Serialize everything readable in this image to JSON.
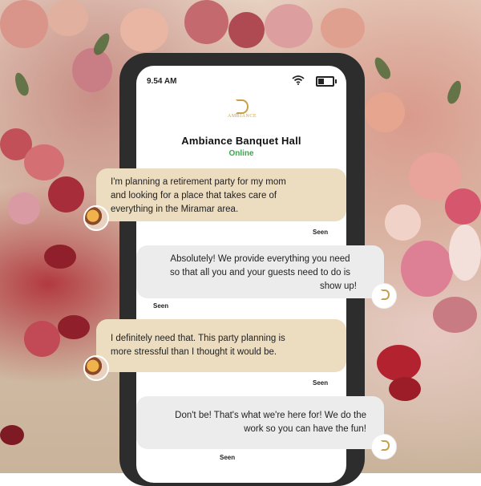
{
  "status_bar": {
    "time": "9.54 AM"
  },
  "header": {
    "logo_text": "AMBIANCE",
    "title": "Ambiance Banquet Hall",
    "status": "Online"
  },
  "messages": [
    {
      "sender": "user",
      "lines": [
        "I'm planning a retirement party for my mom",
        "and looking for a place that takes care of",
        "everything in the Miramar area."
      ],
      "receipt": "Seen"
    },
    {
      "sender": "venue",
      "lines": [
        "Absolutely!  We  provide everything you need",
        "so  that all you and your guests need to do is",
        "show up!"
      ],
      "receipt": "Seen"
    },
    {
      "sender": "user",
      "lines": [
        "I definitely need that. This party planning is",
        "more stressful than I thought it would be."
      ],
      "receipt": "Seen"
    },
    {
      "sender": "venue",
      "lines": [
        "Don't be! That's what we're here for! We do the",
        "work so you can have the fun!"
      ],
      "receipt": "Seen"
    }
  ],
  "colors": {
    "user_bubble": "#ecdcc0",
    "venue_bubble": "#ececec",
    "online": "#3aa84a",
    "logo_gold": "#c9a04a"
  },
  "icons": [
    "wifi-icon",
    "battery-icon",
    "ambiance-logo",
    "user-avatar",
    "venue-avatar"
  ]
}
